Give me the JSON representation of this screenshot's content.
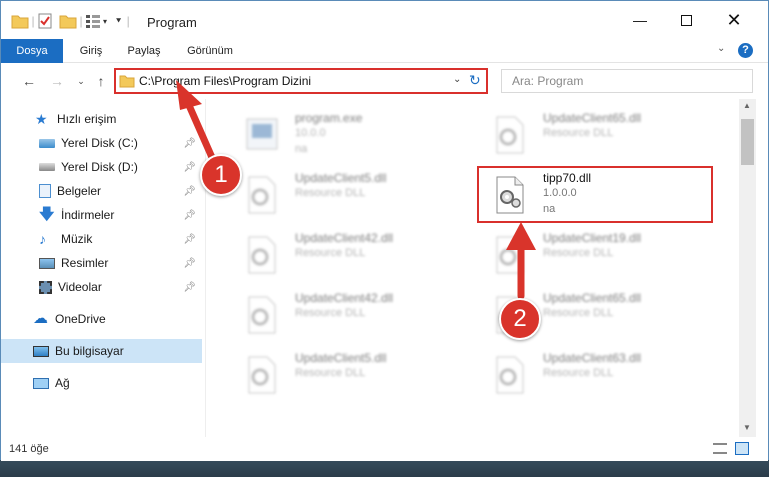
{
  "window": {
    "title": "Program"
  },
  "ribbon": {
    "tabs": [
      {
        "label": "Dosya",
        "active": true
      },
      {
        "label": "Giriş"
      },
      {
        "label": "Paylaş"
      },
      {
        "label": "Görünüm"
      }
    ]
  },
  "nav": {
    "address": "C:\\Program Files\\Program Dizini",
    "search_placeholder": "Ara: Program"
  },
  "sidebar": {
    "items": [
      {
        "label": "Hızlı erişim",
        "icon": "star-icon"
      },
      {
        "label": "Yerel Disk (C:)",
        "icon": "drive-icon",
        "pinned": true
      },
      {
        "label": "Yerel Disk (D:)",
        "icon": "drive-icon",
        "pinned": true
      },
      {
        "label": "Belgeler",
        "icon": "documents-icon",
        "pinned": true
      },
      {
        "label": "İndirmeler",
        "icon": "download-icon",
        "pinned": true
      },
      {
        "label": "Müzik",
        "icon": "music-icon",
        "pinned": true
      },
      {
        "label": "Resimler",
        "icon": "pictures-icon",
        "pinned": true
      },
      {
        "label": "Videolar",
        "icon": "videos-icon",
        "pinned": true
      },
      {
        "label": "OneDrive",
        "icon": "onedrive-icon"
      },
      {
        "label": "Bu bilgisayar",
        "icon": "computer-icon",
        "selected": true
      },
      {
        "label": "Ağ",
        "icon": "network-icon"
      }
    ]
  },
  "files": [
    {
      "name": "program.exe",
      "line2": "10.0.0",
      "line3": "na"
    },
    {
      "name": "UpdateClient65.dll",
      "line2": "Resource DLL"
    },
    {
      "name": "UpdateClient5.dll",
      "line2": "Resource DLL"
    },
    {
      "name": "tipp70.dll",
      "line2": "1.0.0.0",
      "line3": "na",
      "highlighted": true
    },
    {
      "name": "UpdateClient42.dll",
      "line2": "Resource DLL"
    },
    {
      "name": "UpdateClient19.dll",
      "line2": "Resource DLL"
    },
    {
      "name": "UpdateClient42.dll",
      "line2": "Resource DLL"
    },
    {
      "name": "UpdateClient65.dll",
      "line2": "Resource DLL"
    },
    {
      "name": "UpdateClient5.dll",
      "line2": "Resource DLL"
    },
    {
      "name": "UpdateClient63.dll",
      "line2": "Resource DLL"
    }
  ],
  "status": {
    "count": "141 öğe"
  },
  "annotations": {
    "step1": "1",
    "step2": "2"
  },
  "colors": {
    "accent": "#1b6dc2",
    "highlight": "#d9302c",
    "selected": "#cce4f7"
  }
}
